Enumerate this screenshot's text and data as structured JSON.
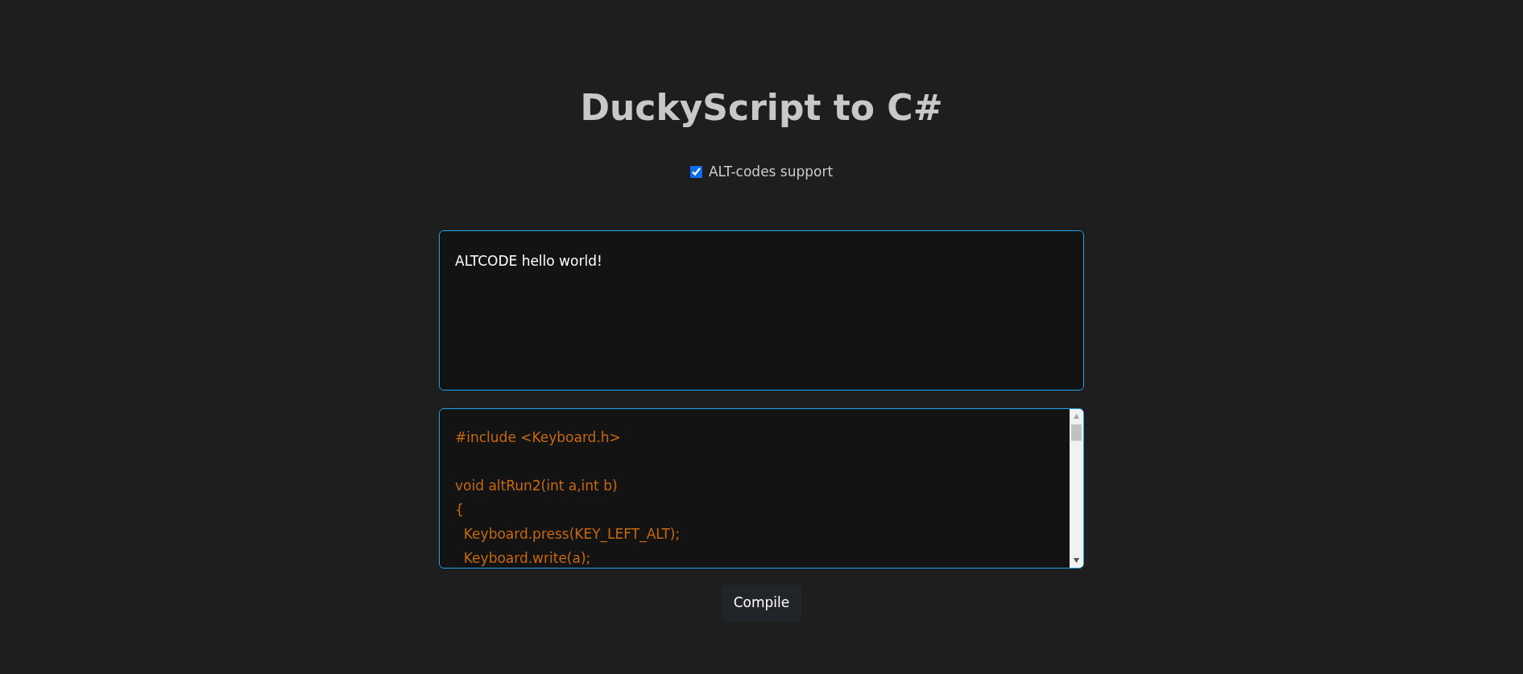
{
  "title": "DuckyScript to C#",
  "alt_codes": {
    "label": "ALT-codes support",
    "checked": true
  },
  "input": {
    "value": "ALTCODE hello world!"
  },
  "output": {
    "blocks": [
      [
        "#include <Keyboard.h>"
      ],
      [
        "void altRun2(int a,int b)",
        "{",
        "  Keyboard.press(KEY_LEFT_ALT);",
        "  Keyboard.write(a);"
      ]
    ]
  },
  "compile_button": "Compile"
}
